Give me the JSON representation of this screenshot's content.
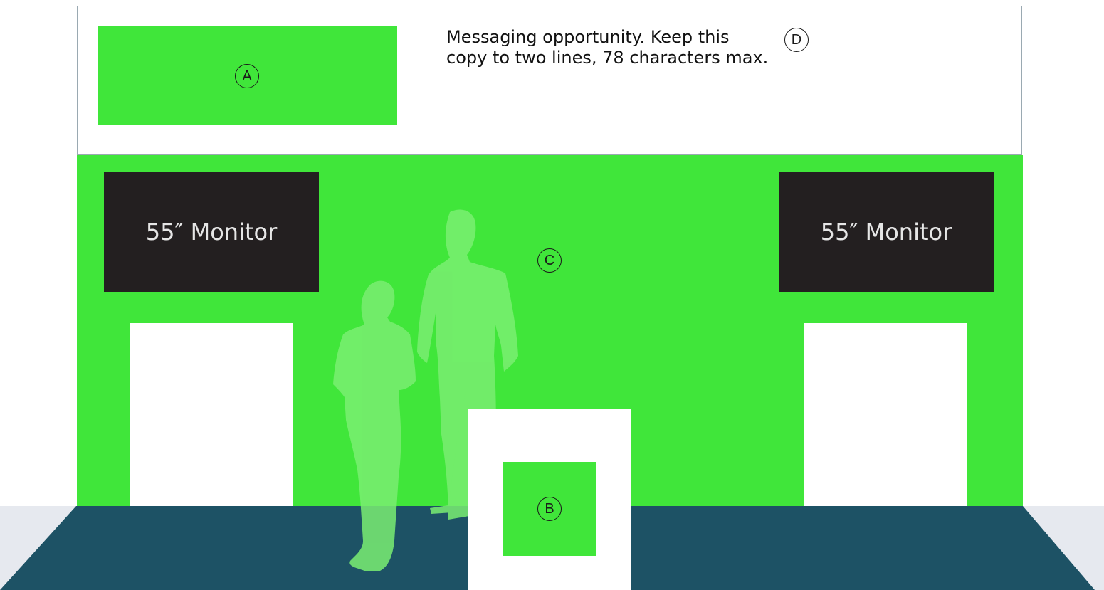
{
  "colors": {
    "brand_green": "#40e63a",
    "floor": "#1d5265",
    "floor_band": "#e6e9ef",
    "monitor": "#231f20",
    "silhouette": "#7aee72",
    "white": "#ffffff"
  },
  "header": {
    "logo_badge": "A",
    "message_line1": "Messaging opportunity. Keep this",
    "message_line2": "copy to two lines, 78 characters max.",
    "message_badge": "D"
  },
  "wall": {
    "badge": "C",
    "monitor_left_label": "55″ Monitor",
    "monitor_right_label": "55″ Monitor"
  },
  "counter": {
    "badge": "B"
  }
}
